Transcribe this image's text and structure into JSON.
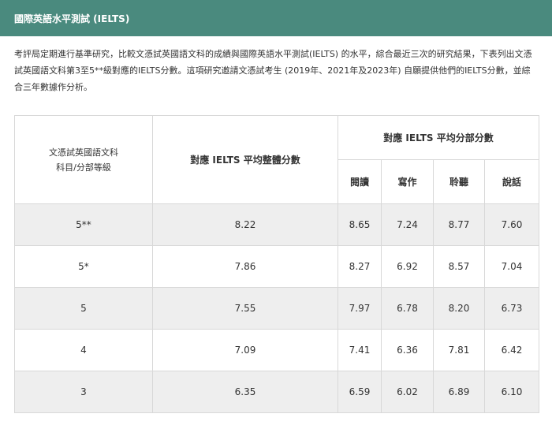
{
  "header": {
    "title": "國際英語水平測試 (IELTS)",
    "bg_color": "#4a8a7e"
  },
  "intro": {
    "text": "考評局定期進行基準研究，比較文憑試英國語文科的成績與國際英語水平測試(IELTS) 的水平，綜合最近三次的研究結果，下表列出文憑試英國語文科第3至5**級對應的IELTS分數。這項研究邀請文憑試考生 (2019年、2021年及2023年) 自願提供他們的IELTS分數，並綜合三年數據作分析。"
  },
  "table": {
    "col1_header_line1": "文憑試英國語文科",
    "col1_header_line2": "科目/分部等級",
    "col2_header": "對應 IELTS 平均整體分數",
    "group_header": "對應 IELTS 平均分部分數",
    "sub_headers": [
      "閱讀",
      "寫作",
      "聆聽",
      "說話"
    ],
    "rows": [
      {
        "level": "5**",
        "overall": "8.22",
        "reading": "8.65",
        "writing": "7.24",
        "listening": "8.77",
        "speaking": "7.60"
      },
      {
        "level": "5*",
        "overall": "7.86",
        "reading": "8.27",
        "writing": "6.92",
        "listening": "8.57",
        "speaking": "7.04"
      },
      {
        "level": "5",
        "overall": "7.55",
        "reading": "7.97",
        "writing": "6.78",
        "listening": "8.20",
        "speaking": "6.73"
      },
      {
        "level": "4",
        "overall": "7.09",
        "reading": "7.41",
        "writing": "6.36",
        "listening": "7.81",
        "speaking": "6.42"
      },
      {
        "level": "3",
        "overall": "6.35",
        "reading": "6.59",
        "writing": "6.02",
        "listening": "6.89",
        "speaking": "6.10"
      }
    ]
  }
}
